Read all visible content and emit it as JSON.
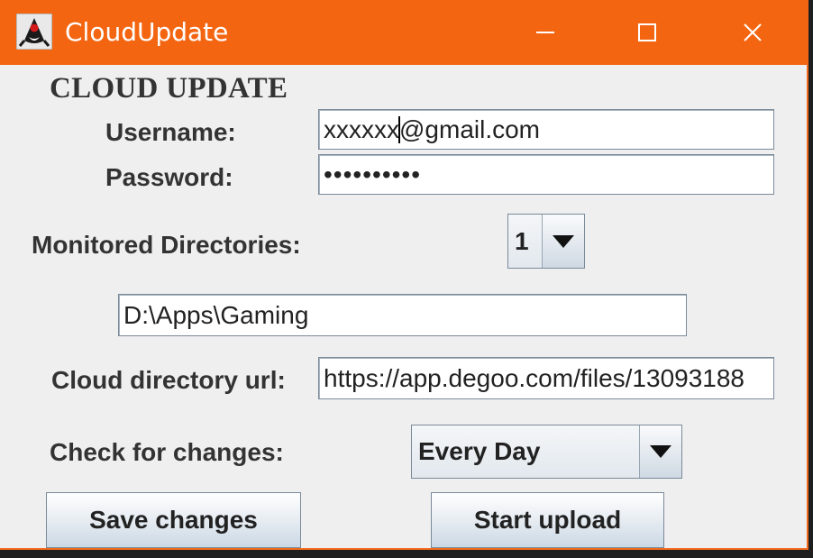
{
  "window": {
    "title": "CloudUpdate",
    "controls": {
      "minimize": "minimize-icon",
      "maximize": "maximize-icon",
      "close": "close-icon"
    },
    "accent_color": "#f46511"
  },
  "form": {
    "heading": "CLOUD UPDATE",
    "username_label": "Username:",
    "username_value_before_caret": "xxxxxx",
    "username_value_after_caret": "@gmail.com",
    "password_label": "Password:",
    "password_value": "••••••••••",
    "monitored_label": "Monitored Directories:",
    "monitored_count": "1",
    "directory_value": "D:\\Apps\\Gaming",
    "cloud_url_label": "Cloud directory url:",
    "cloud_url_value": "https://app.degoo.com/files/13093188",
    "check_label": "Check for changes:",
    "check_value": "Every Day"
  },
  "buttons": {
    "save": "Save changes",
    "start": "Start upload"
  }
}
